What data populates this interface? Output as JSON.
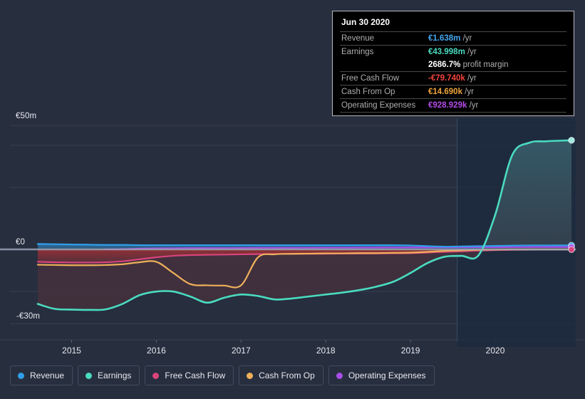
{
  "tooltip": {
    "date": "Jun 30 2020",
    "rows": [
      {
        "label": "Revenue",
        "value": "€1.638m",
        "unit": "/yr",
        "color": "#45a8f0"
      },
      {
        "label": "Earnings",
        "value": "€43.998m",
        "unit": "/yr",
        "color": "#4adbc0"
      },
      {
        "label": "",
        "value": "2686.7%",
        "unit": "profit margin",
        "color": "#ffffff"
      },
      {
        "label": "Free Cash Flow",
        "value": "-€79.740k",
        "unit": "/yr",
        "color": "#f4443c"
      },
      {
        "label": "Cash From Op",
        "value": "€14.690k",
        "unit": "/yr",
        "color": "#f0a63c"
      },
      {
        "label": "Operating Expenses",
        "value": "€928.929k",
        "unit": "/yr",
        "color": "#b44ce8"
      }
    ]
  },
  "legend": {
    "items": [
      {
        "label": "Revenue",
        "color": "#2f9fe8"
      },
      {
        "label": "Earnings",
        "color": "#4adbc0"
      },
      {
        "label": "Free Cash Flow",
        "color": "#d8447c"
      },
      {
        "label": "Cash From Op",
        "color": "#eeb05a"
      },
      {
        "label": "Operating Expenses",
        "color": "#a84ce8"
      }
    ]
  },
  "chart_data": {
    "type": "area",
    "title": "",
    "xlabel": "",
    "ylabel": "",
    "ylim": [
      -30,
      50
    ],
    "xlim": [
      2014.55,
      2020.95
    ],
    "grid": true,
    "legend_position": "bottom",
    "currency": "EUR",
    "y_ticks": [
      {
        "value": 50,
        "label": "€50m"
      },
      {
        "value": 0,
        "label": "€0"
      },
      {
        "value": -30,
        "label": "-€30m"
      }
    ],
    "y_gridlines": [
      50,
      42,
      25,
      0,
      -17,
      -30
    ],
    "x_ticks": [
      {
        "value": 2015,
        "label": "2015"
      },
      {
        "value": 2016,
        "label": "2016"
      },
      {
        "value": 2017,
        "label": "2017"
      },
      {
        "value": 2018,
        "label": "2018"
      },
      {
        "value": 2019,
        "label": "2019"
      },
      {
        "value": 2020,
        "label": "2020"
      }
    ],
    "forecast_start": 2019.55,
    "x": [
      2014.6,
      2014.8,
      2015.0,
      2015.2,
      2015.4,
      2015.6,
      2015.8,
      2016.0,
      2016.2,
      2016.4,
      2016.6,
      2016.8,
      2017.0,
      2017.2,
      2017.4,
      2017.6,
      2017.8,
      2018.0,
      2018.2,
      2018.4,
      2018.6,
      2018.8,
      2019.0,
      2019.2,
      2019.4,
      2019.6,
      2019.8,
      2020.0,
      2020.2,
      2020.4,
      2020.6,
      2020.9
    ],
    "series": [
      {
        "name": "Revenue",
        "color": "#2f9fe8",
        "fill": "rgba(47,120,180,0.45)",
        "values": [
          2.2,
          2.1,
          2.0,
          1.9,
          1.8,
          1.8,
          1.7,
          1.7,
          1.7,
          1.7,
          1.7,
          1.7,
          1.7,
          1.7,
          1.7,
          1.7,
          1.7,
          1.7,
          1.7,
          1.7,
          1.7,
          1.7,
          1.6,
          1.3,
          1.1,
          1.2,
          1.3,
          1.4,
          1.5,
          1.6,
          1.6,
          1.638
        ]
      },
      {
        "name": "Earnings",
        "color": "#4adbc0",
        "fill": "rgba(60,160,160,0.35)",
        "values": [
          -22.0,
          -24.0,
          -24.3,
          -24.4,
          -24.2,
          -22.0,
          -18.5,
          -17.0,
          -17.0,
          -19.0,
          -21.5,
          -19.5,
          -18.2,
          -18.8,
          -20.2,
          -19.8,
          -19.0,
          -18.2,
          -17.4,
          -16.4,
          -15.0,
          -13.0,
          -9.5,
          -5.5,
          -3.0,
          -2.6,
          -2.5,
          14.0,
          38.0,
          43.0,
          43.6,
          43.998
        ]
      },
      {
        "name": "Free Cash Flow",
        "color": "#d8447c",
        "fill": "rgba(150,50,55,0.55)",
        "values": [
          -5.0,
          -5.2,
          -5.3,
          -5.3,
          -5.2,
          -4.8,
          -4.0,
          -3.2,
          -2.6,
          -2.3,
          -2.2,
          -2.1,
          -2.0,
          -1.9,
          -1.85,
          -1.8,
          -1.8,
          -1.75,
          -1.7,
          -1.7,
          -1.65,
          -1.6,
          -1.55,
          -1.3,
          -1.0,
          -0.8,
          -0.5,
          -0.3,
          -0.2,
          -0.1,
          -0.08,
          -0.0797
        ]
      },
      {
        "name": "Cash From Op",
        "color": "#eeb05a",
        "fill": "",
        "values": [
          -6.2,
          -6.3,
          -6.4,
          -6.4,
          -6.3,
          -6.0,
          -5.2,
          -5.0,
          -9.5,
          -14.0,
          -14.5,
          -14.6,
          -14.5,
          -3.2,
          -2.0,
          -1.8,
          -1.7,
          -1.6,
          -1.6,
          -1.5,
          -1.5,
          -1.4,
          -1.3,
          -1.0,
          -0.6,
          -0.4,
          -0.2,
          -0.1,
          0.0,
          0.01,
          0.014,
          0.01469
        ]
      },
      {
        "name": "Operating Expenses",
        "color": "#a84ce8",
        "fill": "",
        "values": [
          null,
          null,
          null,
          null,
          0.0,
          0.1,
          0.3,
          0.4,
          0.45,
          0.5,
          0.5,
          0.5,
          0.55,
          0.6,
          0.6,
          0.62,
          0.65,
          0.68,
          0.7,
          0.72,
          0.75,
          0.78,
          0.8,
          0.82,
          0.85,
          0.87,
          0.88,
          0.9,
          0.91,
          0.92,
          0.925,
          0.928929
        ]
      }
    ],
    "end_markers": [
      {
        "series": "Earnings",
        "x": 2020.9,
        "y": 43.998
      },
      {
        "series": "Revenue",
        "x": 2020.9,
        "y": 1.638
      },
      {
        "series": "Operating Expenses",
        "x": 2020.9,
        "y": 0.928929
      },
      {
        "series": "Free Cash Flow",
        "x": 2020.9,
        "y": -0.0797
      }
    ]
  }
}
